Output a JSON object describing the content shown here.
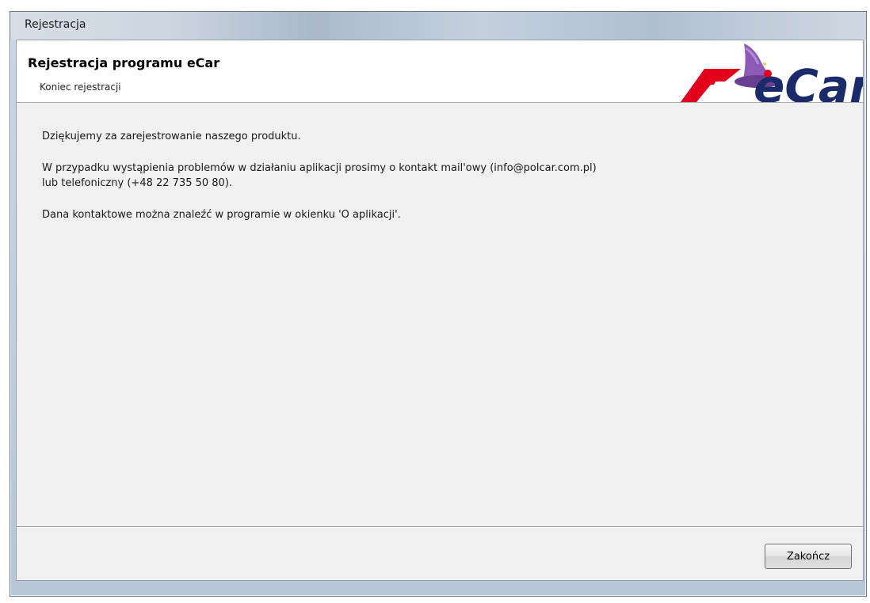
{
  "window": {
    "title": "Rejestracja"
  },
  "header": {
    "title": "Rejestracja programu eCar",
    "subtitle": "Koniec rejestracji",
    "logo_text": "eCar"
  },
  "content": {
    "paragraph1": "Dziękujemy za zarejestrowanie naszego produktu.",
    "paragraph2_line1": "W przypadku wystąpienia problemów w działaniu aplikacji prosimy o kontakt mail'owy (info@polcar.com.pl)",
    "paragraph2_line2": "lub telefoniczny (+48 22 735 50 80).",
    "paragraph3": "Dana kontaktowe można znaleźć w programie w okienku 'O aplikacji'."
  },
  "footer": {
    "finish_label": "Zakończ"
  },
  "colors": {
    "logo_red": "#e3001b",
    "logo_blue": "#1b2a6b",
    "logo_hat_purple": "#8d5bb5"
  }
}
